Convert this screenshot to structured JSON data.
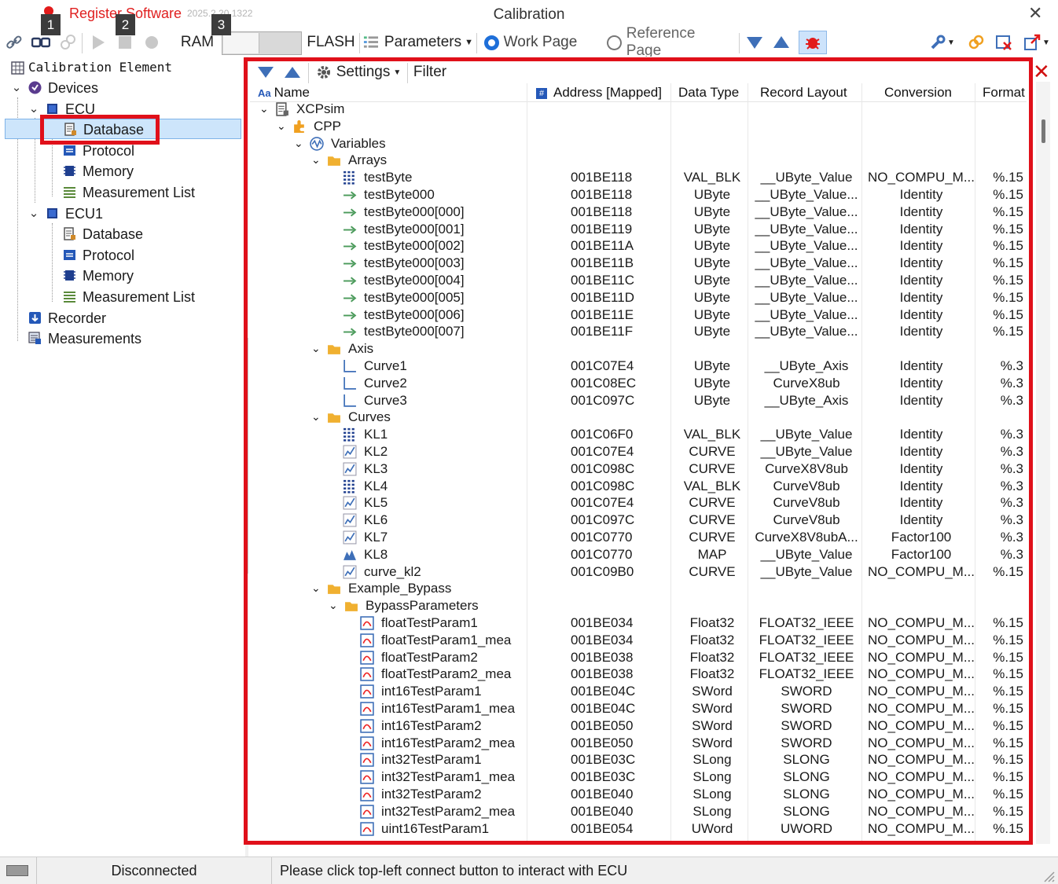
{
  "window": {
    "title": "Calibration",
    "register_label": "Register Software",
    "version": "2025.2.20.1322"
  },
  "badges": [
    "1",
    "2",
    "3"
  ],
  "toolbar": {
    "ram_label": "RAM",
    "flash_label": "FLASH",
    "parameters_label": "Parameters",
    "work_page_label": "Work Page",
    "reference_page_label": "Reference Page",
    "selected_page": "Work Page"
  },
  "left_tree": {
    "title": "Calibration Element",
    "devices_label": "Devices",
    "ecu_label": "ECU",
    "ecu_children": [
      "Database",
      "Protocol",
      "Memory",
      "Measurement List"
    ],
    "ecu1_label": "ECU1",
    "ecu1_children": [
      "Database",
      "Protocol",
      "Memory",
      "Measurement List"
    ],
    "recorder_label": "Recorder",
    "measurements_label": "Measurements",
    "selected": "Database"
  },
  "right_toolbar": {
    "settings_label": "Settings",
    "filter_label": "Filter"
  },
  "columns": {
    "name": "Name",
    "address": "Address [Mapped]",
    "data_type": "Data Type",
    "record_layout": "Record Layout",
    "conversion": "Conversion",
    "format": "Format"
  },
  "rows": [
    {
      "level": 0,
      "kind": "expanded",
      "icon": "document-icon",
      "name": "XCPsim"
    },
    {
      "level": 1,
      "kind": "expanded",
      "icon": "puzzle-icon",
      "name": "CPP"
    },
    {
      "level": 2,
      "kind": "expanded",
      "icon": "wave-icon",
      "name": "Variables"
    },
    {
      "level": 3,
      "kind": "expanded",
      "icon": "folder-icon",
      "name": "Arrays"
    },
    {
      "level": 4,
      "kind": "leaf",
      "icon": "grid-icon",
      "name": "testByte",
      "addr": "001BE118",
      "type": "VAL_BLK",
      "rec": "__UByte_Value",
      "conv": "NO_COMPU_M...",
      "fmt": "%.15"
    },
    {
      "level": 4,
      "kind": "leaf",
      "icon": "arrow-icon",
      "name": "testByte000",
      "addr": "001BE118",
      "type": "UByte",
      "rec": "__UByte_Value...",
      "conv": "Identity",
      "fmt": "%.15"
    },
    {
      "level": 4,
      "kind": "leaf",
      "icon": "arrow-icon",
      "name": "testByte000[000]",
      "addr": "001BE118",
      "type": "UByte",
      "rec": "__UByte_Value...",
      "conv": "Identity",
      "fmt": "%.15"
    },
    {
      "level": 4,
      "kind": "leaf",
      "icon": "arrow-icon",
      "name": "testByte000[001]",
      "addr": "001BE119",
      "type": "UByte",
      "rec": "__UByte_Value...",
      "conv": "Identity",
      "fmt": "%.15"
    },
    {
      "level": 4,
      "kind": "leaf",
      "icon": "arrow-icon",
      "name": "testByte000[002]",
      "addr": "001BE11A",
      "type": "UByte",
      "rec": "__UByte_Value...",
      "conv": "Identity",
      "fmt": "%.15"
    },
    {
      "level": 4,
      "kind": "leaf",
      "icon": "arrow-icon",
      "name": "testByte000[003]",
      "addr": "001BE11B",
      "type": "UByte",
      "rec": "__UByte_Value...",
      "conv": "Identity",
      "fmt": "%.15"
    },
    {
      "level": 4,
      "kind": "leaf",
      "icon": "arrow-icon",
      "name": "testByte000[004]",
      "addr": "001BE11C",
      "type": "UByte",
      "rec": "__UByte_Value...",
      "conv": "Identity",
      "fmt": "%.15"
    },
    {
      "level": 4,
      "kind": "leaf",
      "icon": "arrow-icon",
      "name": "testByte000[005]",
      "addr": "001BE11D",
      "type": "UByte",
      "rec": "__UByte_Value...",
      "conv": "Identity",
      "fmt": "%.15"
    },
    {
      "level": 4,
      "kind": "leaf",
      "icon": "arrow-icon",
      "name": "testByte000[006]",
      "addr": "001BE11E",
      "type": "UByte",
      "rec": "__UByte_Value...",
      "conv": "Identity",
      "fmt": "%.15"
    },
    {
      "level": 4,
      "kind": "leaf",
      "icon": "arrow-icon",
      "name": "testByte000[007]",
      "addr": "001BE11F",
      "type": "UByte",
      "rec": "__UByte_Value...",
      "conv": "Identity",
      "fmt": "%.15"
    },
    {
      "level": 3,
      "kind": "expanded",
      "icon": "folder-icon",
      "name": "Axis"
    },
    {
      "level": 4,
      "kind": "leaf",
      "icon": "axis-icon",
      "name": "Curve1",
      "addr": "001C07E4",
      "type": "UByte",
      "rec": "__UByte_Axis",
      "conv": "Identity",
      "fmt": "%.3"
    },
    {
      "level": 4,
      "kind": "leaf",
      "icon": "axis-icon",
      "name": "Curve2",
      "addr": "001C08EC",
      "type": "UByte",
      "rec": "CurveX8ub",
      "conv": "Identity",
      "fmt": "%.3"
    },
    {
      "level": 4,
      "kind": "leaf",
      "icon": "axis-icon",
      "name": "Curve3",
      "addr": "001C097C",
      "type": "UByte",
      "rec": "__UByte_Axis",
      "conv": "Identity",
      "fmt": "%.3"
    },
    {
      "level": 3,
      "kind": "expanded",
      "icon": "folder-icon",
      "name": "Curves"
    },
    {
      "level": 4,
      "kind": "leaf",
      "icon": "grid-icon",
      "name": "KL1",
      "addr": "001C06F0",
      "type": "VAL_BLK",
      "rec": "__UByte_Value",
      "conv": "Identity",
      "fmt": "%.3"
    },
    {
      "level": 4,
      "kind": "leaf",
      "icon": "curve-icon",
      "name": "KL2",
      "addr": "001C07E4",
      "type": "CURVE",
      "rec": "__UByte_Value",
      "conv": "Identity",
      "fmt": "%.3"
    },
    {
      "level": 4,
      "kind": "leaf",
      "icon": "curve-icon",
      "name": "KL3",
      "addr": "001C098C",
      "type": "CURVE",
      "rec": "CurveX8V8ub",
      "conv": "Identity",
      "fmt": "%.3"
    },
    {
      "level": 4,
      "kind": "leaf",
      "icon": "grid-icon",
      "name": "KL4",
      "addr": "001C098C",
      "type": "VAL_BLK",
      "rec": "CurveV8ub",
      "conv": "Identity",
      "fmt": "%.3"
    },
    {
      "level": 4,
      "kind": "leaf",
      "icon": "curve-icon",
      "name": "KL5",
      "addr": "001C07E4",
      "type": "CURVE",
      "rec": "CurveV8ub",
      "conv": "Identity",
      "fmt": "%.3"
    },
    {
      "level": 4,
      "kind": "leaf",
      "icon": "curve-icon",
      "name": "KL6",
      "addr": "001C097C",
      "type": "CURVE",
      "rec": "CurveV8ub",
      "conv": "Identity",
      "fmt": "%.3"
    },
    {
      "level": 4,
      "kind": "leaf",
      "icon": "curve-icon",
      "name": "KL7",
      "addr": "001C0770",
      "type": "CURVE",
      "rec": "CurveX8V8ubA...",
      "conv": "Factor100",
      "fmt": "%.3"
    },
    {
      "level": 4,
      "kind": "leaf",
      "icon": "map-icon",
      "name": "KL8",
      "addr": "001C0770",
      "type": "MAP",
      "rec": "__UByte_Value",
      "conv": "Factor100",
      "fmt": "%.3"
    },
    {
      "level": 4,
      "kind": "leaf",
      "icon": "curve-icon",
      "name": "curve_kl2",
      "addr": "001C09B0",
      "type": "CURVE",
      "rec": "__UByte_Value",
      "conv": "NO_COMPU_M...",
      "fmt": "%.15"
    },
    {
      "level": 3,
      "kind": "expanded",
      "icon": "folder-icon",
      "name": "Example_Bypass"
    },
    {
      "level": 4,
      "kind": "expanded",
      "icon": "folder-icon",
      "name": "BypassParameters"
    },
    {
      "level": 5,
      "kind": "leaf",
      "icon": "param-icon",
      "name": "floatTestParam1",
      "addr": "001BE034",
      "type": "Float32",
      "rec": "FLOAT32_IEEE",
      "conv": "NO_COMPU_M...",
      "fmt": "%.15"
    },
    {
      "level": 5,
      "kind": "leaf",
      "icon": "param-icon",
      "name": "floatTestParam1_mea",
      "addr": "001BE034",
      "type": "Float32",
      "rec": "FLOAT32_IEEE",
      "conv": "NO_COMPU_M...",
      "fmt": "%.15"
    },
    {
      "level": 5,
      "kind": "leaf",
      "icon": "param-icon",
      "name": "floatTestParam2",
      "addr": "001BE038",
      "type": "Float32",
      "rec": "FLOAT32_IEEE",
      "conv": "NO_COMPU_M...",
      "fmt": "%.15"
    },
    {
      "level": 5,
      "kind": "leaf",
      "icon": "param-icon",
      "name": "floatTestParam2_mea",
      "addr": "001BE038",
      "type": "Float32",
      "rec": "FLOAT32_IEEE",
      "conv": "NO_COMPU_M...",
      "fmt": "%.15"
    },
    {
      "level": 5,
      "kind": "leaf",
      "icon": "param-icon",
      "name": "int16TestParam1",
      "addr": "001BE04C",
      "type": "SWord",
      "rec": "SWORD",
      "conv": "NO_COMPU_M...",
      "fmt": "%.15"
    },
    {
      "level": 5,
      "kind": "leaf",
      "icon": "param-icon",
      "name": "int16TestParam1_mea",
      "addr": "001BE04C",
      "type": "SWord",
      "rec": "SWORD",
      "conv": "NO_COMPU_M...",
      "fmt": "%.15"
    },
    {
      "level": 5,
      "kind": "leaf",
      "icon": "param-icon",
      "name": "int16TestParam2",
      "addr": "001BE050",
      "type": "SWord",
      "rec": "SWORD",
      "conv": "NO_COMPU_M...",
      "fmt": "%.15"
    },
    {
      "level": 5,
      "kind": "leaf",
      "icon": "param-icon",
      "name": "int16TestParam2_mea",
      "addr": "001BE050",
      "type": "SWord",
      "rec": "SWORD",
      "conv": "NO_COMPU_M...",
      "fmt": "%.15"
    },
    {
      "level": 5,
      "kind": "leaf",
      "icon": "param-icon",
      "name": "int32TestParam1",
      "addr": "001BE03C",
      "type": "SLong",
      "rec": "SLONG",
      "conv": "NO_COMPU_M...",
      "fmt": "%.15"
    },
    {
      "level": 5,
      "kind": "leaf",
      "icon": "param-icon",
      "name": "int32TestParam1_mea",
      "addr": "001BE03C",
      "type": "SLong",
      "rec": "SLONG",
      "conv": "NO_COMPU_M...",
      "fmt": "%.15"
    },
    {
      "level": 5,
      "kind": "leaf",
      "icon": "param-icon",
      "name": "int32TestParam2",
      "addr": "001BE040",
      "type": "SLong",
      "rec": "SLONG",
      "conv": "NO_COMPU_M...",
      "fmt": "%.15"
    },
    {
      "level": 5,
      "kind": "leaf",
      "icon": "param-icon",
      "name": "int32TestParam2_mea",
      "addr": "001BE040",
      "type": "SLong",
      "rec": "SLONG",
      "conv": "NO_COMPU_M...",
      "fmt": "%.15"
    },
    {
      "level": 5,
      "kind": "leaf",
      "icon": "param-icon",
      "name": "uint16TestParam1",
      "addr": "001BE054",
      "type": "UWord",
      "rec": "UWORD",
      "conv": "NO_COMPU_M...",
      "fmt": "%.15"
    }
  ],
  "status": {
    "connection": "Disconnected",
    "message": "Please click top-left connect button to interact with ECU"
  },
  "colors": {
    "highlight_red": "#e0101a",
    "selection_blue": "#cde5fb",
    "accent_blue": "#1e6fd9",
    "register_red": "#e02020"
  }
}
